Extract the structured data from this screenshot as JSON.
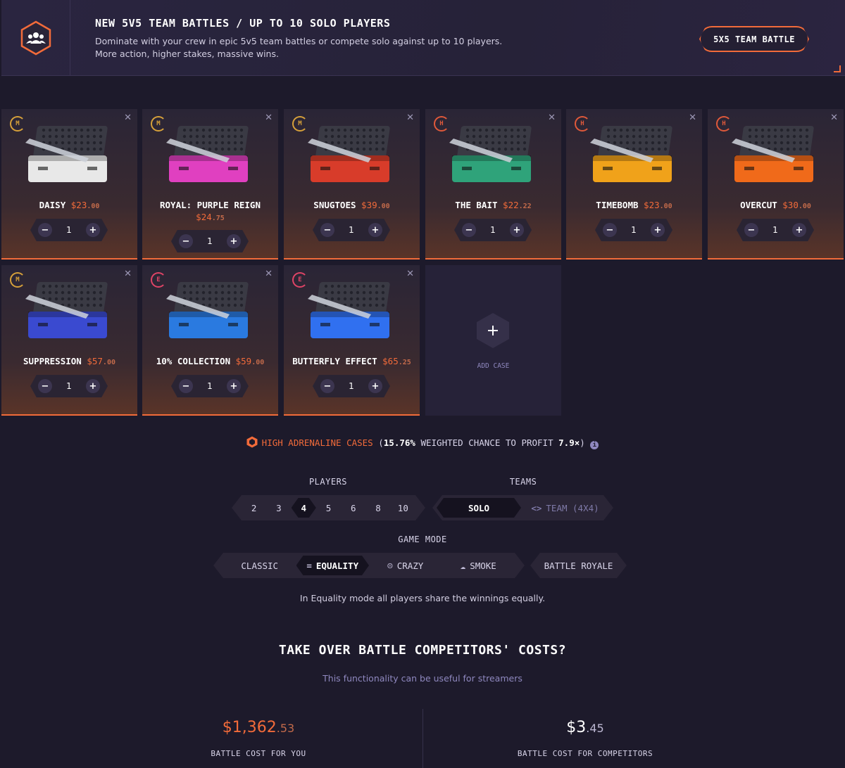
{
  "banner": {
    "title": "NEW 5V5 TEAM BATTLES / UP TO 10 SOLO PLAYERS",
    "description_line1": "Dominate with your crew in epic 5v5 team battles or compete solo against up to 10 players.",
    "description_line2": "More action, higher stakes, massive wins.",
    "button_label": "5X5 TEAM BATTLE",
    "icon": "team-icon"
  },
  "cases": [
    {
      "tier": "M",
      "name": "DAISY",
      "price": "$23",
      "cents": ".00",
      "qty": "1",
      "color": "#e8e8e8"
    },
    {
      "tier": "M",
      "name": "ROYAL: PURPLE REIGN",
      "price": "$24",
      "cents": ".75",
      "qty": "1",
      "color": "#e040c0"
    },
    {
      "tier": "M",
      "name": "SNUGTOES",
      "price": "$39",
      "cents": ".00",
      "qty": "1",
      "color": "#d83c2a"
    },
    {
      "tier": "H",
      "name": "THE BAIT",
      "price": "$22",
      "cents": ".22",
      "qty": "1",
      "color": "#2fa37a"
    },
    {
      "tier": "H",
      "name": "TIMEBOMB",
      "price": "$23",
      "cents": ".00",
      "qty": "1",
      "color": "#f0a21a"
    },
    {
      "tier": "H",
      "name": "OVERCUT",
      "price": "$30",
      "cents": ".00",
      "qty": "1",
      "color": "#f06a1a"
    },
    {
      "tier": "M",
      "name": "SUPPRESSION",
      "price": "$57",
      "cents": ".00",
      "qty": "1",
      "color": "#3a4ad0"
    },
    {
      "tier": "E",
      "name": "10% COLLECTION",
      "price": "$59",
      "cents": ".00",
      "qty": "1",
      "color": "#2a7ae0"
    },
    {
      "tier": "E",
      "name": "BUTTERFLY EFFECT",
      "price": "$65",
      "cents": ".25",
      "qty": "1",
      "color": "#3070f0"
    }
  ],
  "add_case": {
    "label": "ADD CASE"
  },
  "info": {
    "highlight": "HIGH ADRENALINE CASES",
    "rest_open": "(",
    "chance": "15.76%",
    "rest_mid": " WEIGHTED CHANCE TO PROFIT ",
    "multiplier": "7.9×",
    "rest_close": ")"
  },
  "players": {
    "label": "PLAYERS",
    "options": [
      "2",
      "3",
      "4",
      "5",
      "6",
      "8",
      "10"
    ],
    "selected": "4"
  },
  "teams": {
    "label": "TEAMS",
    "options": [
      "SOLO",
      "TEAM (4X4)"
    ],
    "selected": "SOLO"
  },
  "game_mode": {
    "label": "GAME MODE",
    "options": [
      "CLASSIC",
      "EQUALITY",
      "CRAZY",
      "SMOKE",
      "BATTLE ROYALE"
    ],
    "selected": "EQUALITY",
    "description": "In Equality mode all players share the winnings equally."
  },
  "takeover": {
    "title": "TAKE OVER BATTLE COMPETITORS' COSTS?",
    "subtitle": "This functionality can be useful for streamers"
  },
  "costs": {
    "you_main": "$1,362",
    "you_cents": ".53",
    "you_label": "BATTLE COST FOR YOU",
    "comp_main": "$3",
    "comp_cents": ".45",
    "comp_label": "BATTLE COST FOR COMPETITORS"
  },
  "colors": {
    "accent": "#f26b3a",
    "background": "#1d1a2b",
    "muted": "#8f88bf"
  }
}
